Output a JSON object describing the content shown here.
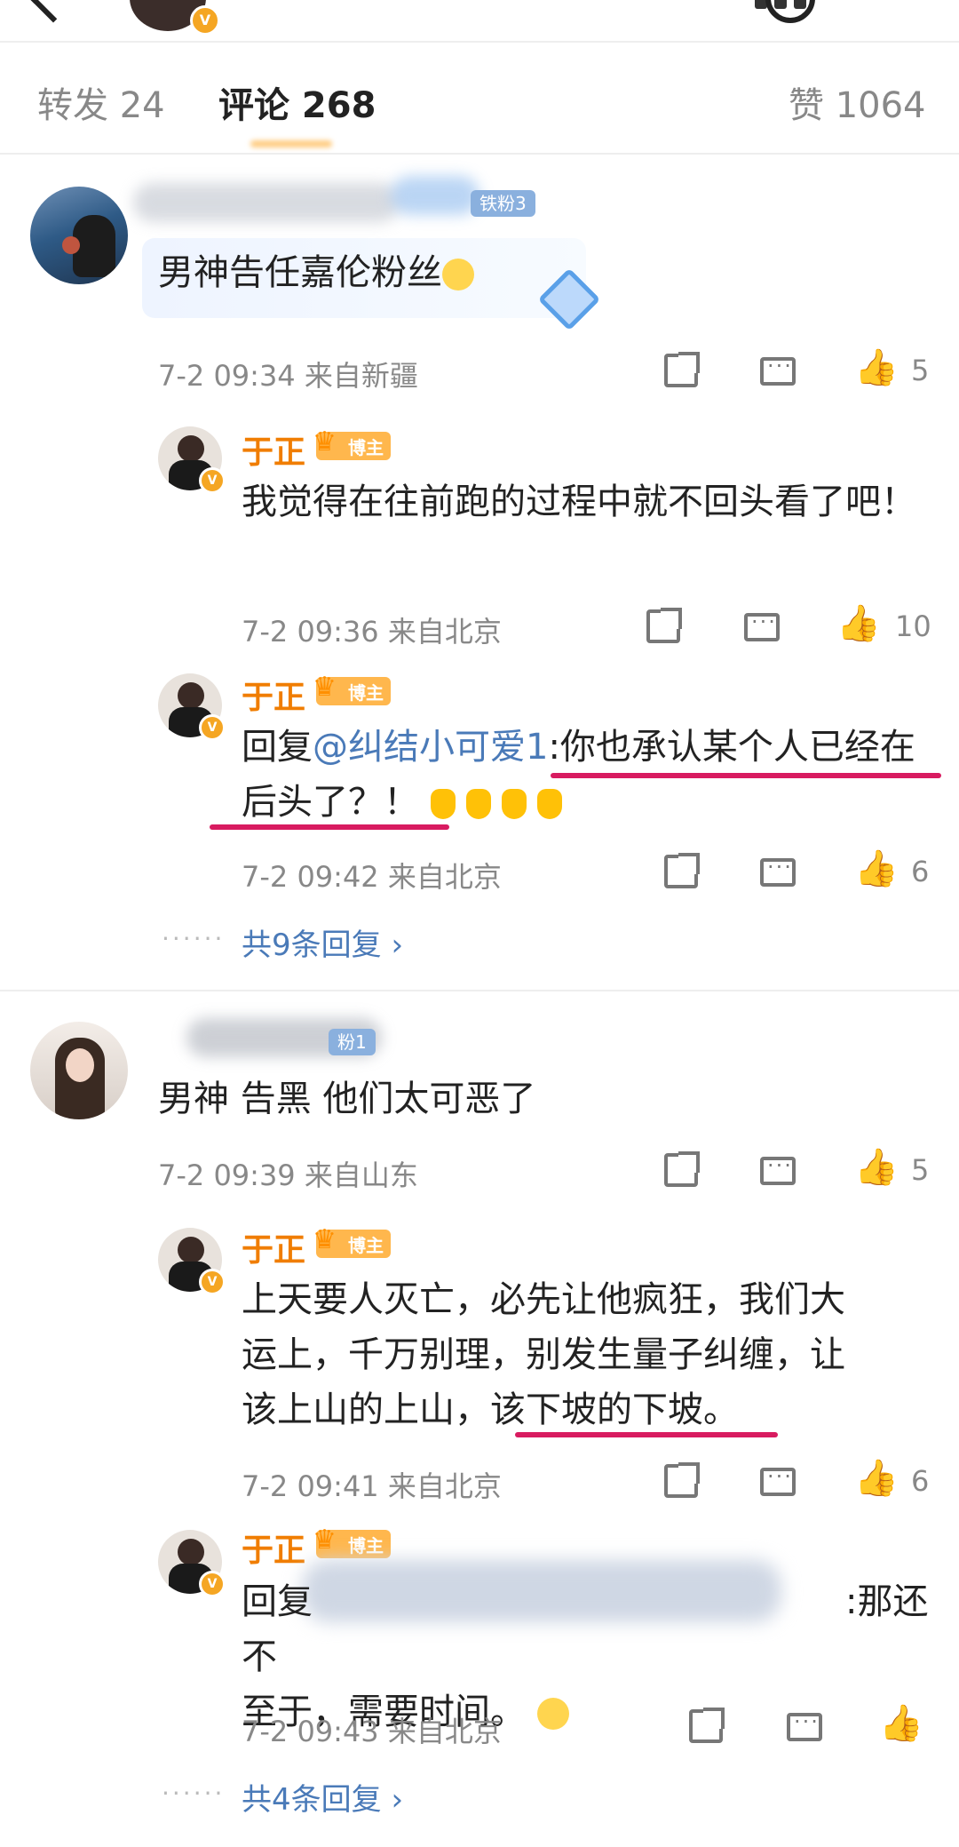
{
  "tabs": {
    "repost": "转发 24",
    "comments": "评论 268",
    "likes": "赞 1064"
  },
  "host_badge": "博主",
  "v_mark": "V",
  "fan_badge": "铁粉3",
  "fan_badge2": "粉1",
  "comments": [
    {
      "text": "男神告任嘉伦粉丝",
      "meta": "7-2 09:34 来自新疆",
      "likes": "5",
      "replies": [
        {
          "user": "于正",
          "text": "我觉得在往前跑的过程中就不回头看了吧！",
          "meta": "7-2 09:36 来自北京",
          "likes": "10"
        },
        {
          "user": "于正",
          "prefix": "回复",
          "mention": "@纠结小可爱1",
          "text": ":你也承认某个人已经在后头了？！",
          "meta": "7-2 09:42 来自北京",
          "likes": "6"
        }
      ],
      "more": "共9条回复 ›"
    },
    {
      "text": "男神 告黑 他们太可恶了",
      "meta": "7-2 09:39 来自山东",
      "likes": "5",
      "replies": [
        {
          "user": "于正",
          "text_line1": "上天要人灭亡，必先让他疯狂，我们大",
          "text_line2": "运上，千万别理，别发生量子纠缠，让",
          "text_line3": "该上山的上山，该下坡的下坡。",
          "meta": "7-2 09:41 来自北京",
          "likes": "6"
        },
        {
          "user": "于正",
          "prefix": "回复",
          "text_tail": ":那还不",
          "text_line2": "至于，需要时间。",
          "meta": "7-2 09:43 来自北京"
        }
      ],
      "more": "共4条回复 ›"
    }
  ],
  "more_dots": "······"
}
